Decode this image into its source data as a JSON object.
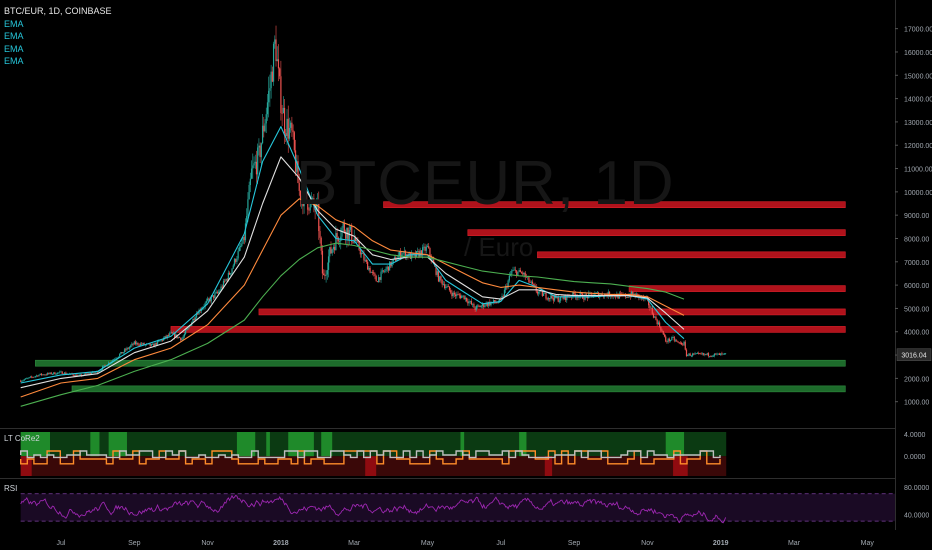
{
  "header": {
    "title": "BTC/EUR, 1D, COINBASE",
    "indicators": [
      "EMA",
      "EMA",
      "EMA",
      "EMA"
    ]
  },
  "watermark": {
    "main": "BTCEUR, 1D",
    "sub": "/ Euro"
  },
  "colors": {
    "background": "#000000",
    "up": "#26a69a",
    "down": "#ef5350",
    "ema_fast": "#26c6da",
    "ema_mid": "#e0e0e0",
    "ema_slow": "#ff8a3d",
    "ema_long": "#4caf50",
    "resistance": "#b0121b",
    "support": "#1d6b2b",
    "rsi": "#9c27b0",
    "last_price_tag": "#2a2a2a"
  },
  "chart_data": [
    {
      "type": "line",
      "panel": "price",
      "title": "BTC/EUR, 1D, COINBASE",
      "y_ticks": [
        "17000.00",
        "16000.00",
        "15000.00",
        "14000.00",
        "13000.00",
        "12000.00",
        "11000.00",
        "10000.00",
        "9000.00",
        "8000.00",
        "7000.00",
        "6000.00",
        "5000.00",
        "4000.00",
        "3000.00",
        "2000.00",
        "1000.00"
      ],
      "ylim": [
        0,
        17800
      ],
      "x_ticks": [
        "Jul",
        "Sep",
        "Nov",
        "2018",
        "Mar",
        "May",
        "Jul",
        "Sep",
        "Nov",
        "2019",
        "Mar",
        "May"
      ],
      "x_tick_months": [
        0,
        2,
        4,
        6,
        8,
        10,
        12,
        14,
        16,
        18,
        20,
        22
      ],
      "x_data_range_months": [
        -1.1,
        18.15
      ],
      "price_path": [
        [
          -1.1,
          1900
        ],
        [
          -0.6,
          2150
        ],
        [
          0,
          2250
        ],
        [
          0.5,
          2100
        ],
        [
          1,
          2300
        ],
        [
          1.5,
          2900
        ],
        [
          2,
          3500
        ],
        [
          2.5,
          3400
        ],
        [
          3,
          3900
        ],
        [
          3.3,
          3700
        ],
        [
          3.7,
          4800
        ],
        [
          4,
          5300
        ],
        [
          4.3,
          5700
        ],
        [
          4.6,
          6500
        ],
        [
          5,
          8000
        ],
        [
          5.2,
          10800
        ],
        [
          5.4,
          11500
        ],
        [
          5.6,
          13500
        ],
        [
          5.7,
          14500
        ],
        [
          5.85,
          16500
        ],
        [
          5.95,
          14500
        ],
        [
          6.1,
          13000
        ],
        [
          6.3,
          12400
        ],
        [
          6.5,
          10000
        ],
        [
          6.8,
          9500
        ],
        [
          7,
          9200
        ],
        [
          7.15,
          6200
        ],
        [
          7.3,
          7200
        ],
        [
          7.5,
          8000
        ],
        [
          7.7,
          8500
        ],
        [
          8,
          8000
        ],
        [
          8.3,
          7000
        ],
        [
          8.6,
          6200
        ],
        [
          9,
          6900
        ],
        [
          9.3,
          7400
        ],
        [
          9.6,
          7200
        ],
        [
          10,
          7600
        ],
        [
          10.3,
          6300
        ],
        [
          10.7,
          5600
        ],
        [
          11,
          5500
        ],
        [
          11.3,
          5000
        ],
        [
          11.6,
          5200
        ],
        [
          12,
          5300
        ],
        [
          12.3,
          6600
        ],
        [
          12.6,
          6500
        ],
        [
          13,
          5700
        ],
        [
          13.3,
          5500
        ],
        [
          13.6,
          5400
        ],
        [
          14,
          5600
        ],
        [
          14.3,
          5500
        ],
        [
          14.6,
          5600
        ],
        [
          15,
          5600
        ],
        [
          15.3,
          5500
        ],
        [
          15.6,
          5600
        ],
        [
          15.8,
          5500
        ],
        [
          16,
          5300
        ],
        [
          16.2,
          4600
        ],
        [
          16.35,
          4200
        ],
        [
          16.5,
          3600
        ],
        [
          16.7,
          3700
        ],
        [
          16.85,
          3500
        ],
        [
          17,
          3500
        ],
        [
          17.05,
          3016
        ]
      ],
      "emas": [
        {
          "name": "EMA",
          "points": [
            [
              -1.1,
              1800
            ],
            [
              0,
              2150
            ],
            [
              1,
              2300
            ],
            [
              2,
              3300
            ],
            [
              3,
              3800
            ],
            [
              4,
              5200
            ],
            [
              5,
              8200
            ],
            [
              5.5,
              11300
            ],
            [
              6,
              12800
            ],
            [
              6.5,
              11000
            ],
            [
              7,
              9000
            ],
            [
              7.5,
              8000
            ],
            [
              8,
              7900
            ],
            [
              8.5,
              6900
            ],
            [
              9,
              6900
            ],
            [
              9.5,
              7300
            ],
            [
              10,
              7300
            ],
            [
              10.5,
              6200
            ],
            [
              11,
              5700
            ],
            [
              11.5,
              5200
            ],
            [
              12,
              5300
            ],
            [
              12.5,
              6200
            ],
            [
              13,
              5900
            ],
            [
              13.5,
              5500
            ],
            [
              14,
              5500
            ],
            [
              14.5,
              5500
            ],
            [
              15,
              5550
            ],
            [
              15.5,
              5550
            ],
            [
              16,
              5400
            ],
            [
              16.5,
              4400
            ],
            [
              17,
              3700
            ]
          ]
        },
        {
          "name": "EMA",
          "points": [
            [
              -1.1,
              1600
            ],
            [
              0,
              2000
            ],
            [
              1,
              2200
            ],
            [
              2,
              3100
            ],
            [
              3,
              3600
            ],
            [
              4,
              4900
            ],
            [
              5,
              7200
            ],
            [
              5.5,
              9500
            ],
            [
              6,
              11500
            ],
            [
              6.5,
              10600
            ],
            [
              7,
              9200
            ],
            [
              7.5,
              8400
            ],
            [
              8,
              8100
            ],
            [
              8.5,
              7300
            ],
            [
              9,
              7100
            ],
            [
              9.5,
              7200
            ],
            [
              10,
              7200
            ],
            [
              10.5,
              6500
            ],
            [
              11,
              6000
            ],
            [
              11.5,
              5500
            ],
            [
              12,
              5400
            ],
            [
              12.5,
              5800
            ],
            [
              13,
              5800
            ],
            [
              13.5,
              5600
            ],
            [
              14,
              5550
            ],
            [
              14.5,
              5550
            ],
            [
              15,
              5550
            ],
            [
              15.5,
              5550
            ],
            [
              16,
              5450
            ],
            [
              16.5,
              4800
            ],
            [
              17,
              4100
            ]
          ]
        },
        {
          "name": "EMA",
          "points": [
            [
              -1.1,
              1200
            ],
            [
              0,
              1800
            ],
            [
              1,
              2000
            ],
            [
              2,
              2800
            ],
            [
              3,
              3300
            ],
            [
              4,
              4300
            ],
            [
              5,
              6000
            ],
            [
              5.5,
              7500
            ],
            [
              6,
              9000
            ],
            [
              6.5,
              9700
            ],
            [
              7,
              9400
            ],
            [
              7.5,
              8800
            ],
            [
              8,
              8500
            ],
            [
              8.5,
              7900
            ],
            [
              9,
              7500
            ],
            [
              9.5,
              7400
            ],
            [
              10,
              7300
            ],
            [
              10.5,
              6900
            ],
            [
              11,
              6500
            ],
            [
              11.5,
              6100
            ],
            [
              12,
              5900
            ],
            [
              12.5,
              6000
            ],
            [
              13,
              5900
            ],
            [
              13.5,
              5800
            ],
            [
              14,
              5700
            ],
            [
              14.5,
              5650
            ],
            [
              15,
              5600
            ],
            [
              15.5,
              5600
            ],
            [
              16,
              5500
            ],
            [
              16.5,
              5100
            ],
            [
              17,
              4700
            ]
          ]
        },
        {
          "name": "EMA",
          "points": [
            [
              -1.1,
              800
            ],
            [
              0,
              1300
            ],
            [
              1,
              1700
            ],
            [
              2,
              2300
            ],
            [
              3,
              2800
            ],
            [
              4,
              3500
            ],
            [
              5,
              4500
            ],
            [
              5.5,
              5500
            ],
            [
              6,
              6400
            ],
            [
              6.5,
              7100
            ],
            [
              7,
              7600
            ],
            [
              7.5,
              7800
            ],
            [
              8,
              7700
            ],
            [
              8.5,
              7500
            ],
            [
              9,
              7300
            ],
            [
              9.5,
              7200
            ],
            [
              10,
              7200
            ],
            [
              10.5,
              7000
            ],
            [
              11,
              6800
            ],
            [
              11.5,
              6600
            ],
            [
              12,
              6500
            ],
            [
              12.5,
              6400
            ],
            [
              13,
              6350
            ],
            [
              13.5,
              6250
            ],
            [
              14,
              6150
            ],
            [
              14.5,
              6100
            ],
            [
              15,
              6050
            ],
            [
              15.5,
              5950
            ],
            [
              16,
              5850
            ],
            [
              16.5,
              5700
            ],
            [
              17,
              5400
            ]
          ]
        }
      ],
      "resistance_zones": [
        {
          "x0": 8.8,
          "x1": 21.4,
          "y": 9450
        },
        {
          "x0": 11.1,
          "x1": 21.4,
          "y": 8250
        },
        {
          "x0": 13.0,
          "x1": 21.4,
          "y": 7300
        },
        {
          "x0": 15.5,
          "x1": 21.4,
          "y": 5850
        },
        {
          "x0": 5.4,
          "x1": 21.4,
          "y": 4850
        },
        {
          "x0": 3.0,
          "x1": 21.4,
          "y": 4100
        }
      ],
      "support_zones": [
        {
          "x0": -0.7,
          "x1": 21.4,
          "y": 2650
        },
        {
          "x0": 0.3,
          "x1": 21.4,
          "y": 1550
        }
      ],
      "last_price": "3016.04"
    },
    {
      "type": "area",
      "panel": "LT CoRe2",
      "title": "LT CoRe2",
      "y_ticks": [
        "4.0000",
        "0.0000"
      ],
      "green_segments": [
        [
          -1.1,
          -0.3
        ],
        [
          0.8,
          1.05
        ],
        [
          1.3,
          1.8
        ],
        [
          4.8,
          5.3
        ],
        [
          5.6,
          5.7
        ],
        [
          6.2,
          6.9
        ],
        [
          7.1,
          7.4
        ],
        [
          10.9,
          11.0
        ],
        [
          12.5,
          12.7
        ],
        [
          16.5,
          17.0
        ]
      ],
      "red_segments": [
        [
          -1.1,
          -0.8
        ],
        [
          8.3,
          8.6
        ],
        [
          13.2,
          13.4
        ],
        [
          16.7,
          17.1
        ]
      ]
    },
    {
      "type": "line",
      "panel": "RSI",
      "title": "RSI",
      "y_ticks": [
        "80.0000",
        "40.0000"
      ],
      "ylim": [
        20,
        90
      ],
      "bands": [
        70,
        30
      ]
    }
  ]
}
